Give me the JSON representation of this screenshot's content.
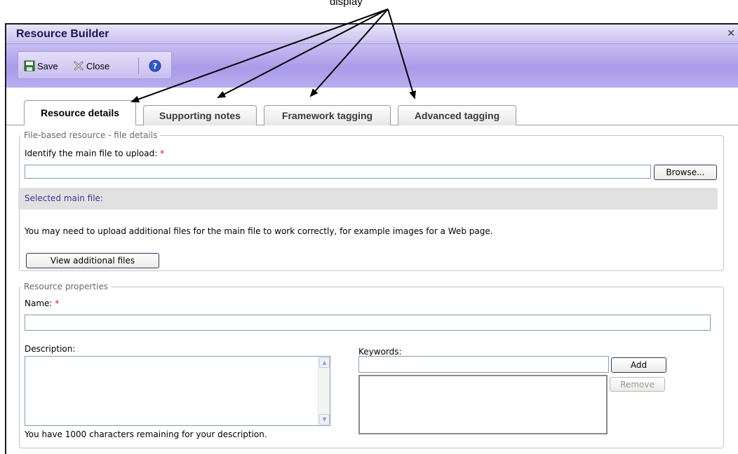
{
  "caption": "display",
  "window": {
    "title": "Resource Builder",
    "close_glyph": "✕"
  },
  "toolbar": {
    "save_label": "Save",
    "close_label": "Close",
    "help_icon": "help-icon"
  },
  "tabs": [
    {
      "label": "Resource details",
      "active": true
    },
    {
      "label": "Supporting notes",
      "active": false
    },
    {
      "label": "Framework tagging",
      "active": false
    },
    {
      "label": "Advanced tagging",
      "active": false
    }
  ],
  "file_section": {
    "legend": "File-based resource - file details",
    "identify_label": "Identify the main file to upload:",
    "required_mark": "*",
    "file_value": "",
    "browse_label": "Browse...",
    "selected_label": "Selected main file:",
    "info_text": "You may need to upload additional files for the main file to work correctly, for example images for a Web page.",
    "view_additional_label": "View additional files"
  },
  "properties": {
    "legend": "Resource properties",
    "name_label": "Name:",
    "required_mark": "*",
    "name_value": "",
    "description_label": "Description:",
    "description_value": "",
    "remaining_text": "You have 1000 characters remaining for your description.",
    "keywords_label": "Keywords:",
    "keyword_value": "",
    "add_label": "Add",
    "remove_label": "Remove"
  },
  "colors": {
    "title_text": "#1e1550",
    "toolbar_band": "#a99be8",
    "selected_label": "#3f3594",
    "required": "#dd1111"
  }
}
